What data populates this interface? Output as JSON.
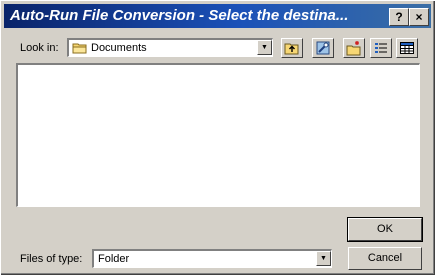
{
  "window": {
    "title": "Auto-Run File Conversion - Select the destina...",
    "help_button": "?",
    "close_button": "×"
  },
  "look_in": {
    "label": "Look in:",
    "folder": "Documents",
    "icon": "folder-icon"
  },
  "toolbar": {
    "buttons": [
      {
        "name": "up-one-level",
        "icon": "up-folder-icon"
      },
      {
        "name": "desktop",
        "icon": "desktop-icon"
      },
      {
        "name": "new-folder",
        "icon": "new-folder-icon"
      },
      {
        "name": "list-view",
        "icon": "list-view-icon"
      },
      {
        "name": "details-view",
        "icon": "details-view-icon"
      }
    ]
  },
  "files_of_type": {
    "label": "Files of type:",
    "value": "Folder"
  },
  "buttons": {
    "ok": "OK",
    "cancel": "Cancel"
  }
}
